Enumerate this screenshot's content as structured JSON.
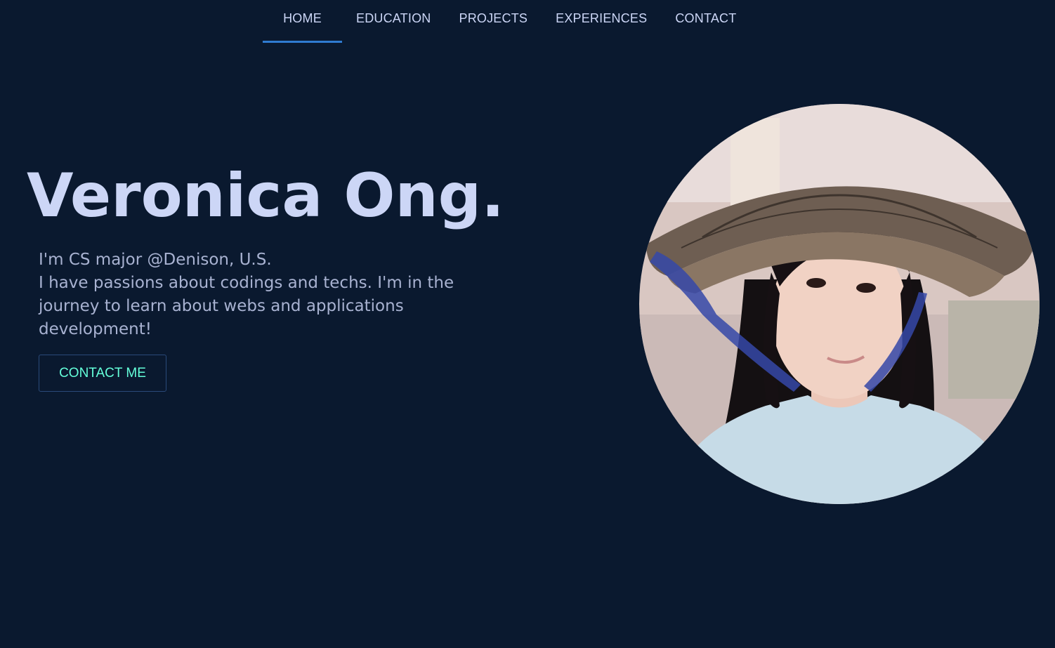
{
  "nav": {
    "items": [
      {
        "label": "HOME",
        "active": true
      },
      {
        "label": "EDUCATION",
        "active": false
      },
      {
        "label": "PROJECTS",
        "active": false
      },
      {
        "label": "EXPERIENCES",
        "active": false
      },
      {
        "label": "CONTACT",
        "active": false
      }
    ]
  },
  "hero": {
    "name": "Veronica Ong.",
    "line1": "I'm CS major @Denison, U.S.",
    "line2": "I have passions about codings and techs. I'm in the journey to learn about webs and applications development!",
    "button_label": "CONTACT ME"
  },
  "colors": {
    "background": "#0a192f",
    "heading": "#ccd6f6",
    "body_text": "#a8b2d1",
    "accent": "#64ffda",
    "nav_underline": "#2f7bd1"
  }
}
